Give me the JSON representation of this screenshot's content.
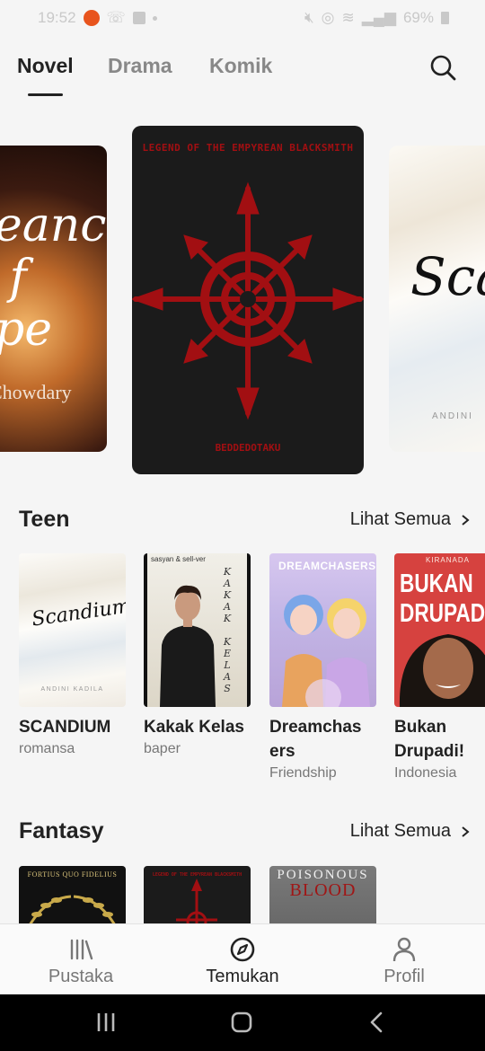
{
  "status_bar": {
    "time": "19:52",
    "battery": "69%"
  },
  "top_tabs": [
    {
      "label": "Novel",
      "active": true
    },
    {
      "label": "Drama",
      "active": false
    },
    {
      "label": "Komik",
      "active": false
    }
  ],
  "carousel": {
    "left": {
      "title": "eance\nf\npe",
      "author": "Chowdary"
    },
    "center": {
      "title": "LEGEND OF THE EMPYREAN BLACKSMITH",
      "author": "BEDDEDOTAKU"
    },
    "right": {
      "title": "Scan",
      "author": "ANDINI"
    }
  },
  "sections": [
    {
      "title": "Teen",
      "see_all": "Lihat Semua",
      "books": [
        {
          "title": "SCANDIUM",
          "tag": "romansa",
          "cover_text": "Scandium",
          "cover_sub": "ANDINI KADILA"
        },
        {
          "title": "Kakak Kelas",
          "tag": "baper",
          "cover_text": "KAKAK KELAS",
          "cover_sub": "sasyan & sell-ver"
        },
        {
          "title": "Dreamchasers",
          "tag": "Friendship",
          "cover_text": "DREAMCHASERS"
        },
        {
          "title": "Bukan Drupadi!",
          "tag": "Indonesia",
          "cover_text": "BUKAN DRUPADI",
          "cover_sub": "KIRANADA"
        }
      ]
    },
    {
      "title": "Fantasy",
      "see_all": "Lihat Semua",
      "books": [
        {
          "cover_text": "FORTIUS QUO FIDELIUS"
        },
        {
          "cover_text": "LEGEND OF THE EMPYREAN BLACKSMITH"
        },
        {
          "cover_text": "POISONOUS",
          "cover_sub": "BLOOD"
        }
      ]
    }
  ],
  "bottom_nav": [
    {
      "label": "Pustaka",
      "icon": "library-icon",
      "active": false
    },
    {
      "label": "Temukan",
      "icon": "compass-icon",
      "active": true
    },
    {
      "label": "Profil",
      "icon": "person-icon",
      "active": false
    }
  ],
  "colors": {
    "accent": "#222222",
    "cover_red": "#a20f12",
    "background": "#f5f5f5"
  }
}
